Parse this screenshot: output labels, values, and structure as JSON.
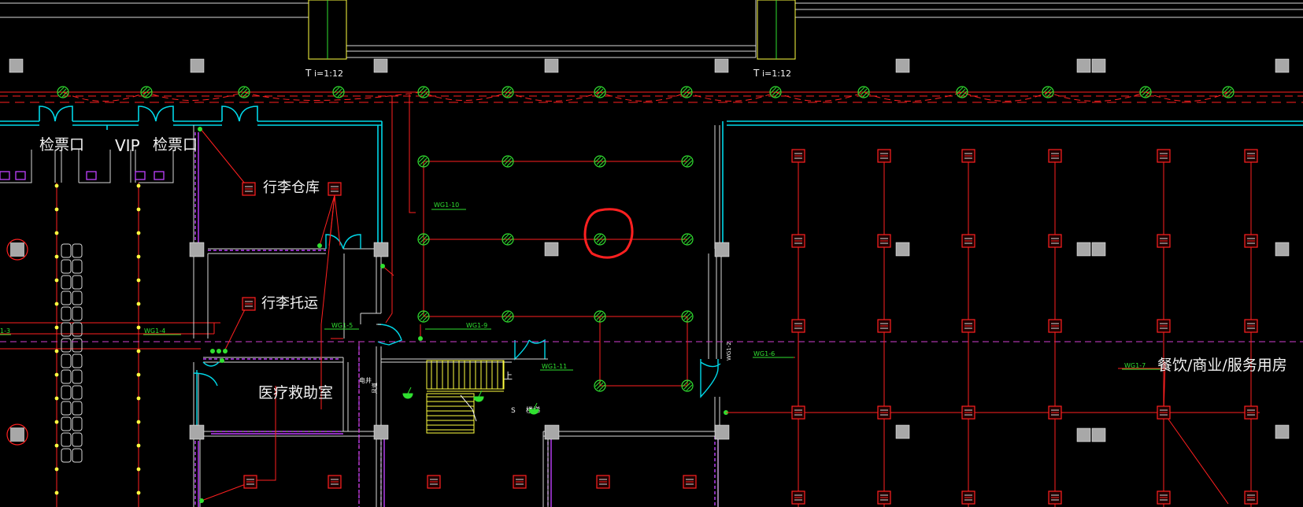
{
  "drawing": {
    "background": "#000000",
    "colors": {
      "wiring": "#ff2020",
      "wall_line": "#d8d8d8",
      "partition_cyan": "#00d8e8",
      "hatch_magenta": "#c040ff",
      "fixture_green": "#30e030",
      "label_white": "#f2f2f2",
      "label_green": "#30e030",
      "dashed_magenta": "#d040d0",
      "highlight_red": "#ff2020",
      "yellow": "#ffff40",
      "column_gray": "#a8a8a8"
    },
    "room_labels": {
      "ticket_gate_left": "检票口",
      "vip_label": "VIP",
      "ticket_gate_vip": "检票口",
      "luggage_storage": "行李仓库",
      "luggage_checkin": "行李托运",
      "medical_room": "医疗救助室",
      "catering": "餐饮/商业/服务用房"
    },
    "slope_labels": [
      "i=1:12",
      "i=1:12"
    ],
    "circuit_labels": {
      "wg1_3": "1-3",
      "wg1_4": "WG1-4",
      "wg1_5": "WG1-5",
      "wg1_6": "WG1-6",
      "wg1_7": "WG1-7",
      "wg1_9": "WG1-9",
      "wg1_10": "WG1-10",
      "wg1_11": "WG1-11"
    },
    "small_labels": {
      "up": "上",
      "electric_shaft": "电井",
      "stair_note": "楼梯",
      "stair_prefix": "S",
      "riser_text": "风道",
      "vertical_code": "WG1-2"
    },
    "highlight": "red-circle-marker"
  }
}
